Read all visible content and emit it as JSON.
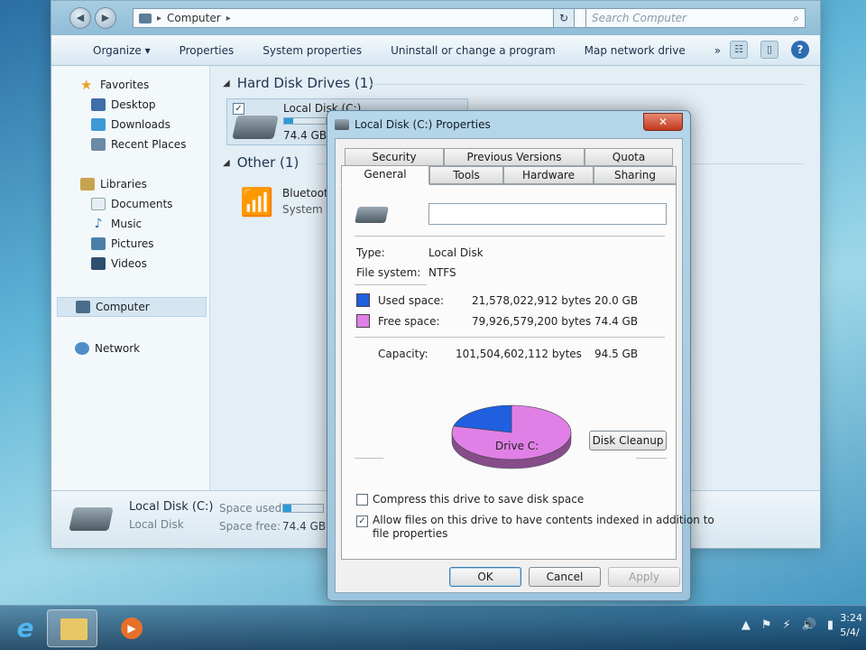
{
  "explorer": {
    "address": "Computer",
    "search_placeholder": "Search Computer",
    "toolbar": {
      "organize": "Organize ▾",
      "properties": "Properties",
      "system_properties": "System properties",
      "uninstall": "Uninstall or change a program",
      "map_drive": "Map network drive",
      "more": "»"
    },
    "nav": {
      "favorites": "Favorites",
      "desktop": "Desktop",
      "downloads": "Downloads",
      "recent": "Recent Places",
      "libraries": "Libraries",
      "documents": "Documents",
      "music": "Music",
      "pictures": "Pictures",
      "videos": "Videos",
      "computer": "Computer",
      "network": "Network"
    },
    "content": {
      "hdd_group": "Hard Disk Drives (1)",
      "other_group": "Other (1)",
      "drive_name": "Local Disk (C:)",
      "drive_free": "74.4 GB",
      "drive_used_fraction": 0.21,
      "bt_name": "Bluetoot",
      "bt_sub": "System F"
    },
    "details": {
      "title": "Local Disk (C:)",
      "subtitle": "Local Disk",
      "space_used_label": "Space used:",
      "space_free_label": "Space free:",
      "space_free_value": "74.4 GB",
      "used_fraction": 0.21
    }
  },
  "dialog": {
    "title": "Local Disk (C:) Properties",
    "close": "✕",
    "tabs": {
      "security": "Security",
      "previous": "Previous Versions",
      "quota": "Quota",
      "general": "General",
      "tools": "Tools",
      "hardware": "Hardware",
      "sharing": "Sharing"
    },
    "name_value": "",
    "type_label": "Type:",
    "type_value": "Local Disk",
    "fs_label": "File system:",
    "fs_value": "NTFS",
    "used_label": "Used space:",
    "used_bytes": "21,578,022,912 bytes",
    "used_gb": "20.0 GB",
    "free_label": "Free space:",
    "free_bytes": "79,926,579,200 bytes",
    "free_gb": "74.4 GB",
    "capacity_label": "Capacity:",
    "capacity_bytes": "101,504,602,112 bytes",
    "capacity_gb": "94.5 GB",
    "drive_label": "Drive C:",
    "cleanup": "Disk Cleanup",
    "compress_label": "Compress this drive to save disk space",
    "compress_checked": false,
    "index_label_1": "Allow files on this drive to have contents indexed in addition to",
    "index_label_2": "file properties",
    "index_checked": true,
    "ok": "OK",
    "cancel": "Cancel",
    "apply": "Apply",
    "colors": {
      "used": "#1f5fe0",
      "free": "#e080e6"
    }
  },
  "taskbar": {
    "clock_time": "3:24",
    "clock_date": "5/4/"
  },
  "chart_data": {
    "type": "pie",
    "categories": [
      "Used space",
      "Free space"
    ],
    "values": [
      21578022912,
      79926579200
    ],
    "colors": [
      "#1f5fe0",
      "#e080e6"
    ]
  }
}
